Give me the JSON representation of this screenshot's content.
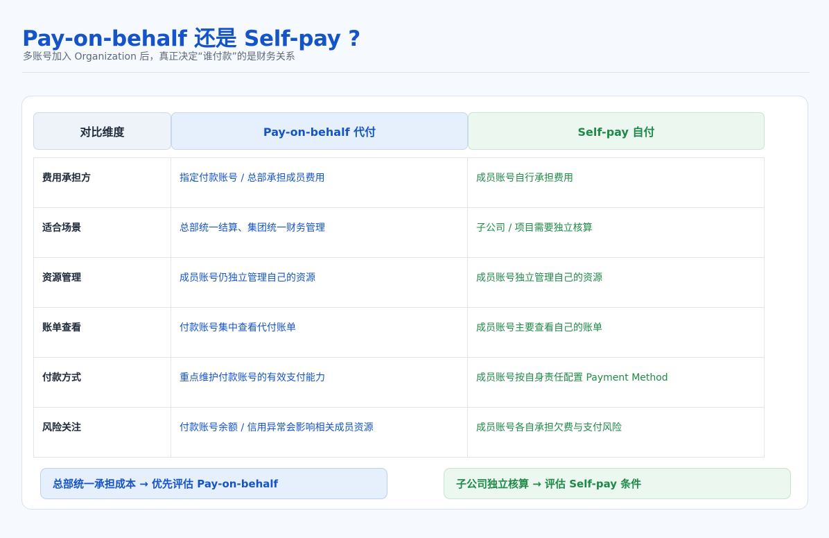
{
  "header": {
    "title": "Pay-on-behalf 还是 Self-pay ?",
    "subtitle": "多账号加入 Organization 后，真正决定“谁付款”的是财务关系"
  },
  "table": {
    "columns": [
      "对比维度",
      "Pay-on-behalf 代付",
      "Self-pay 自付"
    ],
    "rows": [
      {
        "dimension": "费用承担方",
        "pay_on_behalf": "指定付款账号 / 总部承担成员费用",
        "self_pay": "成员账号自行承担费用"
      },
      {
        "dimension": "适合场景",
        "pay_on_behalf": "总部统一结算、集团统一财务管理",
        "self_pay": "子公司 / 项目需要独立核算"
      },
      {
        "dimension": "资源管理",
        "pay_on_behalf": "成员账号仍独立管理自己的资源",
        "self_pay": "成员账号独立管理自己的资源"
      },
      {
        "dimension": "账单查看",
        "pay_on_behalf": "付款账号集中查看代付账单",
        "self_pay": "成员账号主要查看自己的账单"
      },
      {
        "dimension": "付款方式",
        "pay_on_behalf": "重点维护付款账号的有效支付能力",
        "self_pay": "成员账号按自身责任配置 Payment Method"
      },
      {
        "dimension": "风险关注",
        "pay_on_behalf": "付款账号余额 / 信用异常会影响相关成员资源",
        "self_pay": "成员账号各自承担欠费与支付风险"
      }
    ]
  },
  "notes": {
    "left": "总部统一承担成本 → 优先评估 Pay-on-behalf",
    "right": "子公司独立核算 → 评估 Self-pay 条件"
  },
  "colors": {
    "blue": "#1554c8",
    "green": "#1f8a47",
    "text": "#1e2a3a"
  }
}
